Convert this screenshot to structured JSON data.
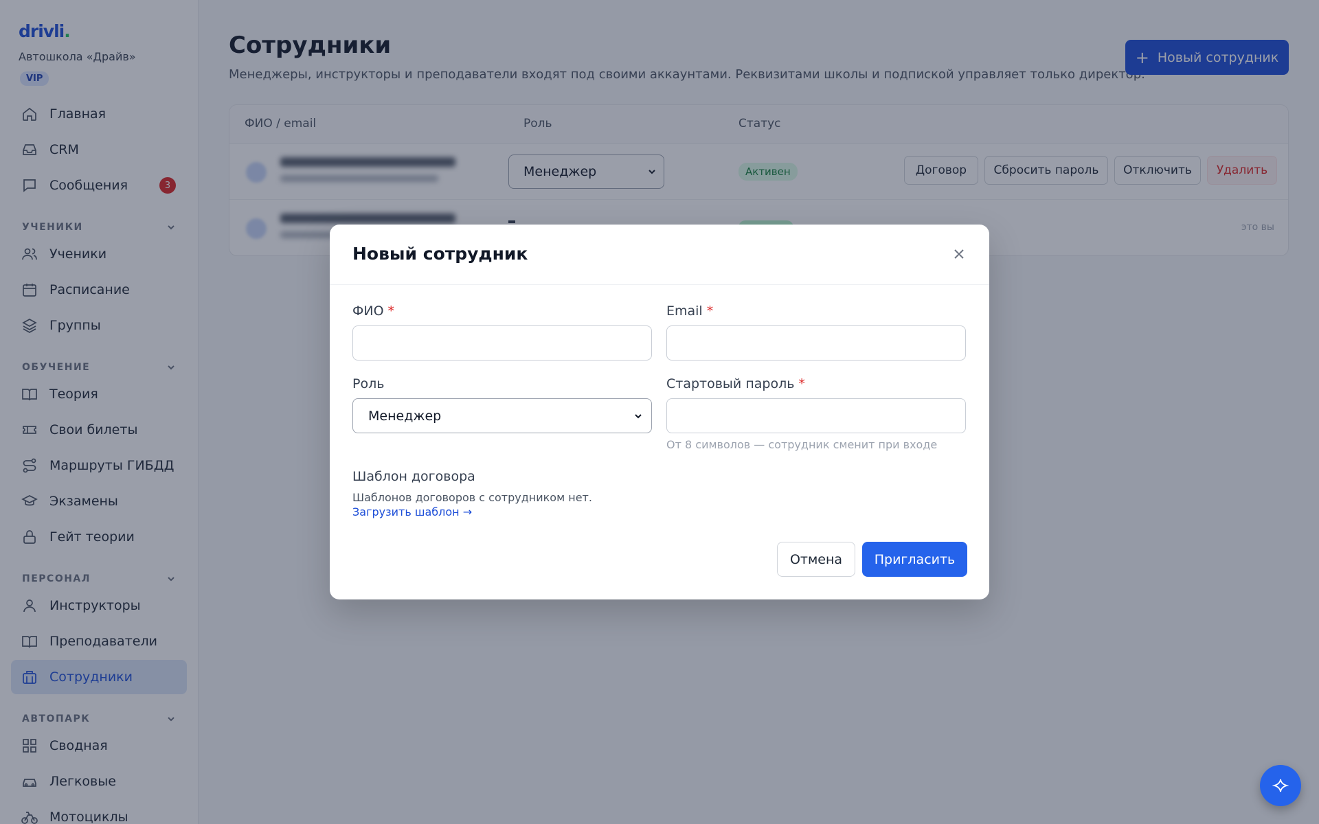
{
  "app": {
    "logo_text": "drivli",
    "logo_dot": ".",
    "school_name": "Автошкола «Драйв»",
    "plan_badge": "VIP"
  },
  "sidebar": {
    "top_items": [
      {
        "label": "Главная",
        "icon": "home-icon"
      },
      {
        "label": "CRM",
        "icon": "inbox-icon"
      },
      {
        "label": "Сообщения",
        "icon": "message-icon",
        "badge": "3"
      }
    ],
    "sections": [
      {
        "title": "УЧЕНИКИ",
        "items": [
          {
            "label": "Ученики",
            "icon": "users-icon"
          },
          {
            "label": "Расписание",
            "icon": "calendar-icon"
          },
          {
            "label": "Группы",
            "icon": "layers-icon"
          }
        ]
      },
      {
        "title": "ОБУЧЕНИЕ",
        "items": [
          {
            "label": "Теория",
            "icon": "book-open-icon"
          },
          {
            "label": "Свои билеты",
            "icon": "ticket-icon"
          },
          {
            "label": "Маршруты ГИБДД",
            "icon": "route-icon"
          },
          {
            "label": "Экзамены",
            "icon": "graduation-cap-icon"
          },
          {
            "label": "Гейт теории",
            "icon": "lock-icon"
          }
        ]
      },
      {
        "title": "ПЕРСОНАЛ",
        "items": [
          {
            "label": "Инструкторы",
            "icon": "user-icon"
          },
          {
            "label": "Преподаватели",
            "icon": "book-icon"
          },
          {
            "label": "Сотрудники",
            "icon": "briefcase-icon",
            "active": true
          }
        ]
      },
      {
        "title": "АВТОПАРК",
        "items": [
          {
            "label": "Сводная",
            "icon": "grid-icon"
          },
          {
            "label": "Легковые",
            "icon": "car-icon"
          },
          {
            "label": "Мотоциклы",
            "icon": "bike-icon"
          }
        ]
      }
    ]
  },
  "page": {
    "title": "Сотрудники",
    "subtitle": "Менеджеры, инструкторы и преподаватели входят под своими аккаунтами. Реквизитами школы и подпиской управляет только директор.",
    "new_button": "Новый сотрудник"
  },
  "table": {
    "columns": [
      "ФИО / email",
      "Роль",
      "Статус"
    ],
    "rows": [
      {
        "role": "Менеджер",
        "status": "Активен",
        "actions": [
          "Договор",
          "Сбросить пароль",
          "Отключить",
          "Удалить"
        ]
      },
      {
        "note": "это вы"
      }
    ]
  },
  "modal": {
    "title": "Новый сотрудник",
    "fio_label": "ФИО",
    "email_label": "Email",
    "role_label": "Роль",
    "role_value": "Менеджер",
    "password_label": "Стартовый пароль",
    "password_hint": "От 8 символов — сотрудник сменит при входе",
    "required_mark": "*",
    "template_title": "Шаблон договора",
    "template_text": "Шаблонов договоров с сотрудником нет.",
    "template_link": "Загрузить шаблон →",
    "cancel": "Отмена",
    "invite": "Пригласить"
  },
  "colors": {
    "accent": "#1d4ed8",
    "danger": "#dc2626",
    "success": "#15803d"
  }
}
